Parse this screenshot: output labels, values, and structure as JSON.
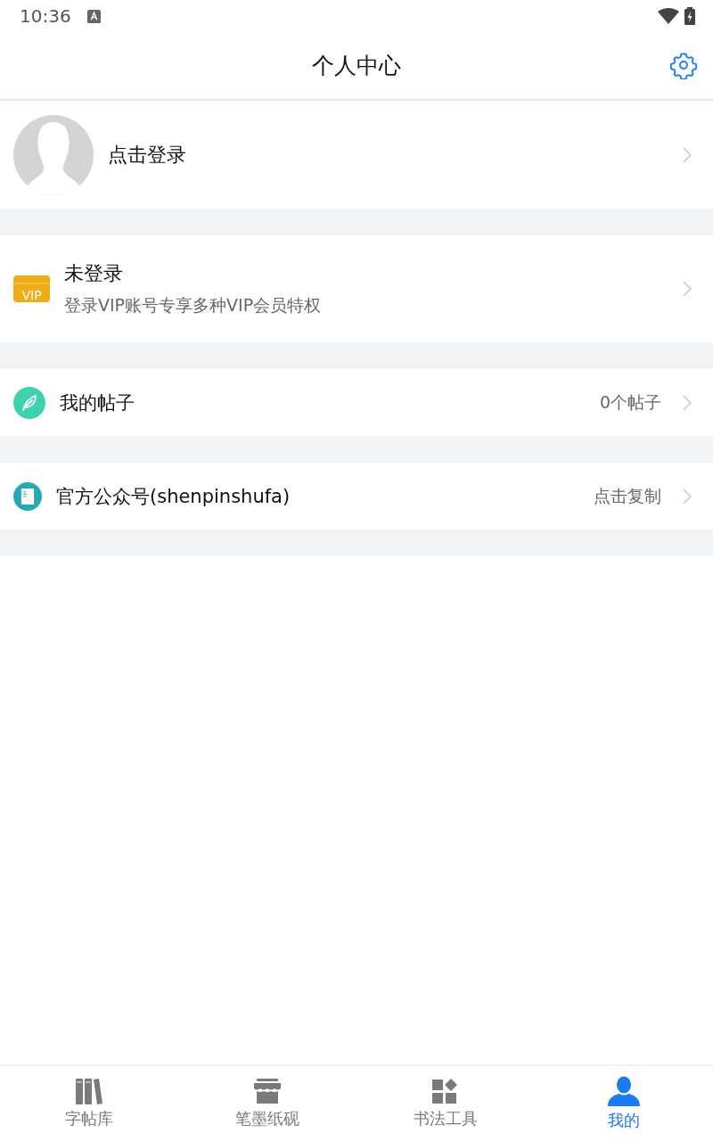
{
  "status_bar": {
    "time": "10:36"
  },
  "header": {
    "title": "个人中心"
  },
  "profile": {
    "label": "点击登录"
  },
  "vip": {
    "title": "未登录",
    "subtitle": "登录VIP账号专享多种VIP会员特权",
    "badge": "VIP"
  },
  "menu": [
    {
      "kind": "leaf",
      "label": "我的帖子",
      "value": "0个帖子"
    },
    {
      "kind": "doc",
      "label": "官方公众号(shenpinshufa)",
      "value": "点击复制"
    }
  ],
  "tabs": [
    {
      "kind": "books",
      "label": "字帖库",
      "selected": false
    },
    {
      "kind": "shop",
      "label": "笔墨纸砚",
      "selected": false
    },
    {
      "kind": "tools",
      "label": "书法工具",
      "selected": false
    },
    {
      "kind": "person",
      "label": "我的",
      "selected": true
    }
  ]
}
